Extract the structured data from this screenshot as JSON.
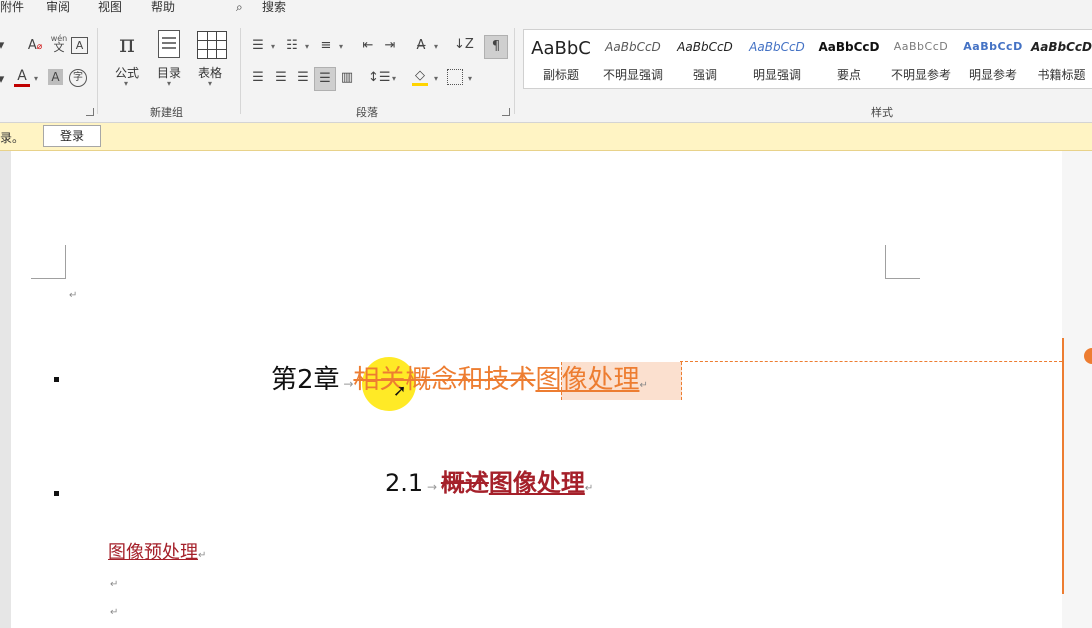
{
  "tabs": [
    "附件",
    "审阅",
    "视图",
    "帮助"
  ],
  "search": {
    "label": "搜索"
  },
  "ribbon": {
    "insert_group": {
      "label": "新建组",
      "formula": "公式",
      "toc": "目录",
      "table": "表格"
    },
    "paragraph_group": {
      "label": "段落"
    },
    "styles_group": {
      "label": "样式",
      "items": [
        {
          "preview": "AaBbC",
          "name": "副标题"
        },
        {
          "preview": "AaBbCcD",
          "name": "不明显强调"
        },
        {
          "preview": "AaBbCcD",
          "name": "强调"
        },
        {
          "preview": "AaBbCcD",
          "name": "明显强调"
        },
        {
          "preview": "AaBbCcD",
          "name": "要点"
        },
        {
          "preview": "AaBbCcD",
          "name": "不明显参考"
        },
        {
          "preview": "AaBbCcD",
          "name": "明显参考"
        },
        {
          "preview": "AaBbCcD",
          "name": "书籍标题"
        }
      ]
    },
    "font_group": {
      "wen_top": "wén",
      "wen_bottom": "文",
      "char_a": "A",
      "zi": "字"
    }
  },
  "message_bar": {
    "text": "录。",
    "button": "登录"
  },
  "document": {
    "heading1": {
      "number": "第2章",
      "deleted_text": "相关概念和技术",
      "inserted_text": "图像处理"
    },
    "heading2": {
      "number": "2.1",
      "deleted_text": "概述",
      "inserted_text": "图像处理"
    },
    "body_inserted": "图像预处理",
    "para_mark": "↵"
  },
  "colors": {
    "accent": "#ed7d31",
    "revision_red": "#a5202a",
    "highlight": "#ffe600"
  }
}
